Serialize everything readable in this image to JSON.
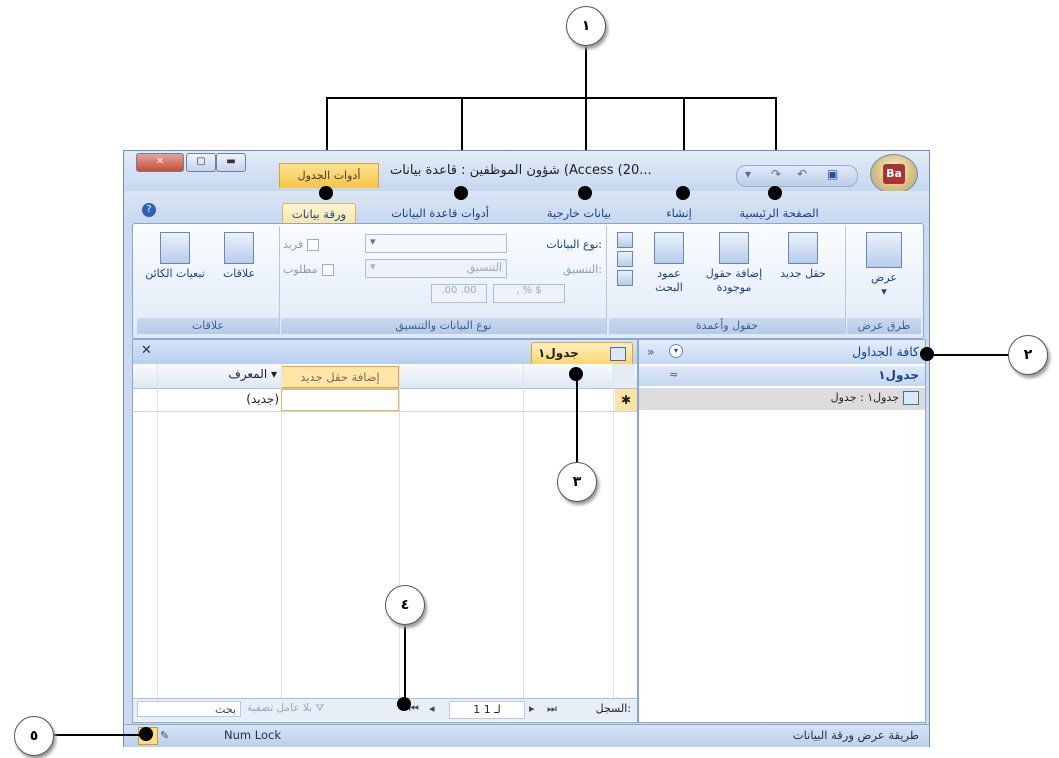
{
  "callouts": [
    "١",
    "٢",
    "٣",
    "٤",
    "٥"
  ],
  "window": {
    "title": "شؤون الموظفين : قاعدة بيانات (Access (20...",
    "contextual_tab": "أدوات الجدول",
    "close": "✕",
    "max": "▢",
    "min": "▬",
    "office_logo": "Ba"
  },
  "tabs": [
    "الصفحة الرئيسية",
    "إنشاء",
    "بيانات خارجية",
    "أدوات قاعدة البيانات",
    "ورقة بيانات"
  ],
  "ribbon": {
    "groups": {
      "views": "طرق عرض",
      "fields_columns": "حقول وأعمدة",
      "datatype": "نوع البيانات والتنسيق",
      "relationships": "علاقات"
    },
    "view_button": "عرض",
    "new_field": "حقل جديد",
    "add_existing": "إضافة حقول موجودة",
    "lookup_column": "عمود البحث",
    "datatype_label": "نوع البيانات:",
    "format_label": "التنسيق:",
    "format_value": "التنسيق",
    "unique": "فريد",
    "required": "مطلوب",
    "relationships": "علاقات",
    "dependencies": "تبعيات الكائن"
  },
  "nav_pane": {
    "header": "كافة الجداول",
    "group": "جدول١",
    "item": "جدول١ : جدول"
  },
  "document": {
    "tab": "جدول١",
    "close": "✕",
    "col_id": "المعرف",
    "col_add": "إضافة حقل جديد",
    "new_row": "(جديد)",
    "new_marker": "✱"
  },
  "record_nav": {
    "label": "السجل:",
    "position": "1 لـ 1",
    "no_filter": "بلا عامل تصفية",
    "search": "بحث"
  },
  "status": {
    "left_text": "طريقة عرض ورقة البيانات",
    "num_lock": "Num Lock"
  }
}
